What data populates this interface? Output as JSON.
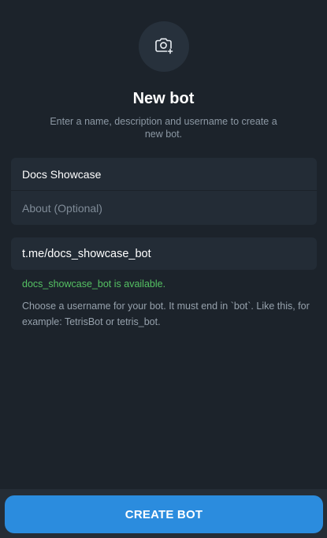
{
  "header": {
    "camera_icon": "camera-plus-icon",
    "title": "New bot",
    "subtitle": "Enter a name, description and username to create a new bot."
  },
  "form": {
    "name_value": "Docs Showcase",
    "about_placeholder": "About (Optional)",
    "username_value": "t.me/docs_showcase_bot"
  },
  "status": {
    "available_text": "docs_showcase_bot is available.",
    "hint_text": "Choose a username for your bot. It must end in `bot`. Like this, for example: TetrisBot or tetris_bot."
  },
  "footer": {
    "create_label": "CREATE BOT"
  },
  "colors": {
    "background": "#1c232b",
    "card": "#232c36",
    "accent": "#2b8cde",
    "success": "#55c163"
  }
}
